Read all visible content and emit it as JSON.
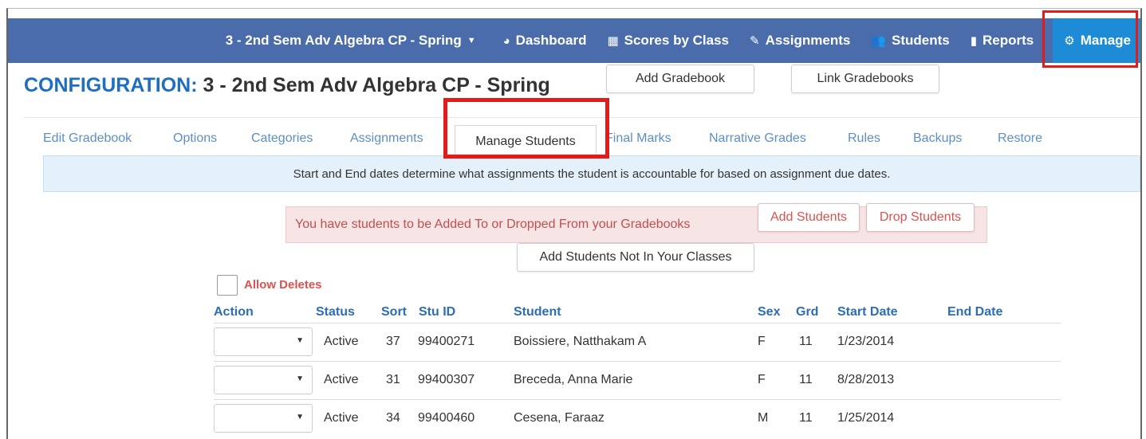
{
  "topnav": {
    "class_select": "3 - 2nd Sem Adv Algebra CP - Spring",
    "items": [
      {
        "label": "Dashboard",
        "icon": "dashboard-icon"
      },
      {
        "label": "Scores by Class",
        "icon": "grid-icon"
      },
      {
        "label": "Assignments",
        "icon": "edit-icon"
      },
      {
        "label": "Students",
        "icon": "users-icon"
      },
      {
        "label": "Reports",
        "icon": "document-icon"
      },
      {
        "label": "Manage",
        "icon": "gear-icon"
      }
    ]
  },
  "config": {
    "label": "CONFIGURATION:",
    "class_name": "3 - 2nd Sem Adv Algebra CP - Spring",
    "add_gradebook": "Add Gradebook",
    "link_gradebooks": "Link Gradebooks"
  },
  "tabs": [
    "Edit Gradebook",
    "Options",
    "Categories",
    "Assignments",
    "Manage Students",
    "Final Marks",
    "Narrative Grades",
    "Rules",
    "Backups",
    "Restore"
  ],
  "info": "Start and End dates determine what assignments the student is accountable for based on assignment due dates.",
  "alert": {
    "text": "You have students to be Added To or Dropped From your Gradebooks",
    "add_students": "Add Students",
    "drop_students": "Drop Students"
  },
  "add_not_in_classes": "Add Students Not In Your Classes",
  "allow_deletes": "Allow Deletes",
  "table": {
    "headers": {
      "action": "Action",
      "status": "Status",
      "sort": "Sort",
      "stu_id": "Stu ID",
      "student": "Student",
      "sex": "Sex",
      "grd": "Grd",
      "start_date": "Start Date",
      "end_date": "End Date"
    },
    "rows": [
      {
        "status": "Active",
        "sort": "37",
        "stu_id": "99400271",
        "student": "Boissiere, Natthakam A",
        "sex": "F",
        "grd": "11",
        "start_date": "1/23/2014",
        "end_date": ""
      },
      {
        "status": "Active",
        "sort": "31",
        "stu_id": "99400307",
        "student": "Breceda, Anna Marie",
        "sex": "F",
        "grd": "11",
        "start_date": "8/28/2013",
        "end_date": ""
      },
      {
        "status": "Active",
        "sort": "34",
        "stu_id": "99400460",
        "student": "Cesena, Faraaz",
        "sex": "M",
        "grd": "11",
        "start_date": "1/25/2014",
        "end_date": ""
      }
    ]
  },
  "colors": {
    "nav": "#4a6cab",
    "active_nav": "#1e8bd6",
    "highlight": "#e31b1b",
    "header_text": "#2d6db5"
  }
}
